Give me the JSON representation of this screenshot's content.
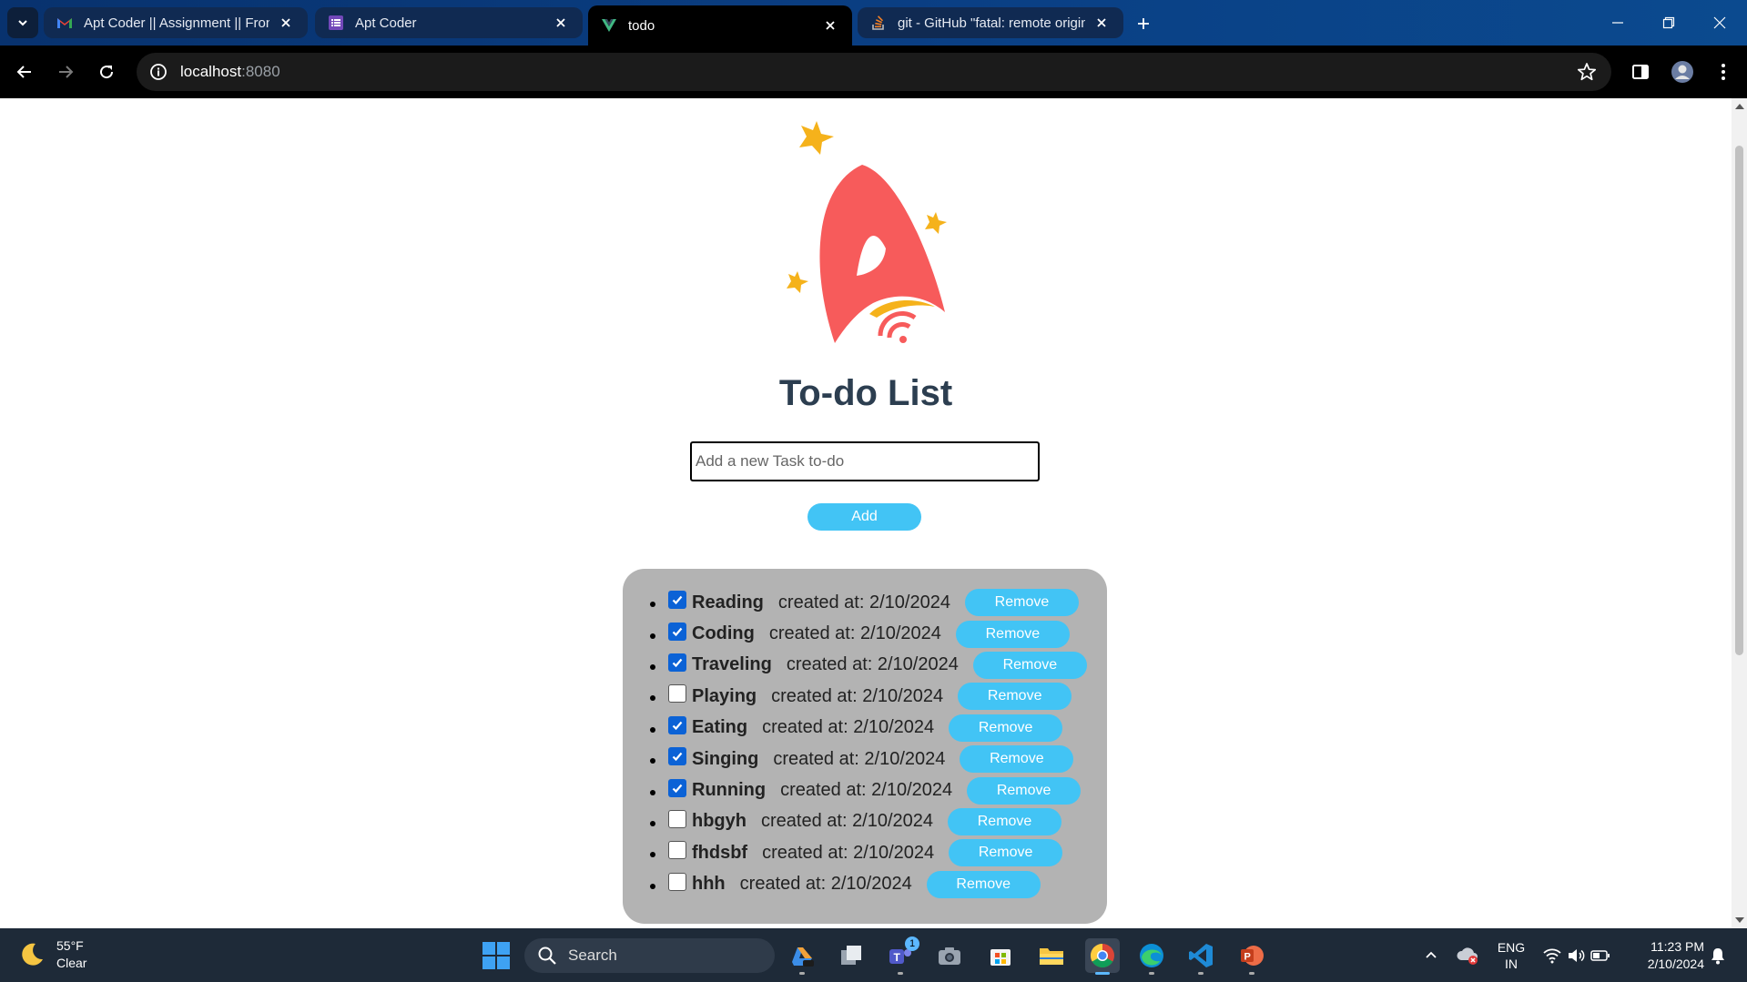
{
  "browser": {
    "tabs": [
      {
        "title": "Apt Coder || Assignment || Front",
        "favicon": "gmail-icon",
        "active": false
      },
      {
        "title": "Apt Coder",
        "favicon": "forms-icon",
        "active": false
      },
      {
        "title": "todo",
        "favicon": "vue-icon",
        "active": true
      },
      {
        "title": "git - GitHub \"fatal: remote origin",
        "favicon": "stackoverflow-icon",
        "active": false
      }
    ],
    "address": {
      "host": "localhost",
      "port": ":8080"
    }
  },
  "app": {
    "title": "To-do List",
    "input_placeholder": "Add a new Task to-do",
    "add_label": "Add",
    "remove_label": "Remove",
    "created_prefix": "created at: ",
    "todos": [
      {
        "name": "Reading",
        "date": "2/10/2024",
        "done": true
      },
      {
        "name": "Coding",
        "date": "2/10/2024",
        "done": true
      },
      {
        "name": "Traveling",
        "date": "2/10/2024",
        "done": true
      },
      {
        "name": "Playing",
        "date": "2/10/2024",
        "done": false
      },
      {
        "name": "Eating",
        "date": "2/10/2024",
        "done": true
      },
      {
        "name": "Singing",
        "date": "2/10/2024",
        "done": true
      },
      {
        "name": "Running",
        "date": "2/10/2024",
        "done": true
      },
      {
        "name": "hbgyh",
        "date": "2/10/2024",
        "done": false
      },
      {
        "name": "fhdsbf",
        "date": "2/10/2024",
        "done": false
      },
      {
        "name": "hhh",
        "date": "2/10/2024",
        "done": false
      }
    ]
  },
  "taskbar": {
    "weather": {
      "temp": "55°F",
      "condition": "Clear"
    },
    "search_label": "Search",
    "teams_badge": "1",
    "lang": {
      "line1": "ENG",
      "line2": "IN"
    },
    "clock": {
      "time": "11:23 PM",
      "date": "2/10/2024"
    }
  },
  "colors": {
    "accent": "#42c4f5",
    "title": "#2c3e50",
    "list_bg": "#b3b3b3",
    "checkbox": "#0b62d6"
  }
}
